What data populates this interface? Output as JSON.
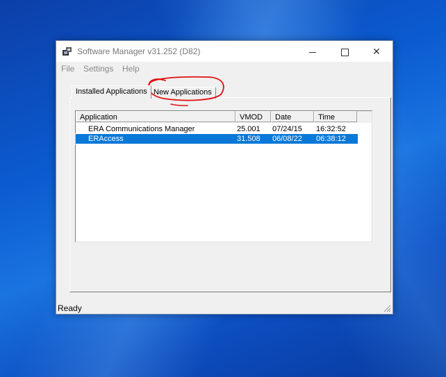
{
  "window": {
    "title": "Software Manager v31.252 (D82)",
    "icon": "software-manager-app-icon"
  },
  "menu": [
    "File",
    "Settings",
    "Help"
  ],
  "tabs": [
    {
      "label": "Installed Applications",
      "active": true
    },
    {
      "label": "New Applications",
      "active": false
    }
  ],
  "table": {
    "columns": [
      "Application",
      "VMOD",
      "Date",
      "Time"
    ],
    "rows": [
      {
        "application": "ERA Communications Manager",
        "vmod": "25.001",
        "date": "07/24/15",
        "time": "16:32:52",
        "selected": false
      },
      {
        "application": "ERAccess",
        "vmod": "31.508",
        "date": "06/08/22",
        "time": "06:38:12",
        "selected": true
      }
    ]
  },
  "status": "Ready",
  "colors": {
    "selection": "#0a78d7",
    "annotation": "#e01010",
    "desktop": "#0b5bd0"
  }
}
